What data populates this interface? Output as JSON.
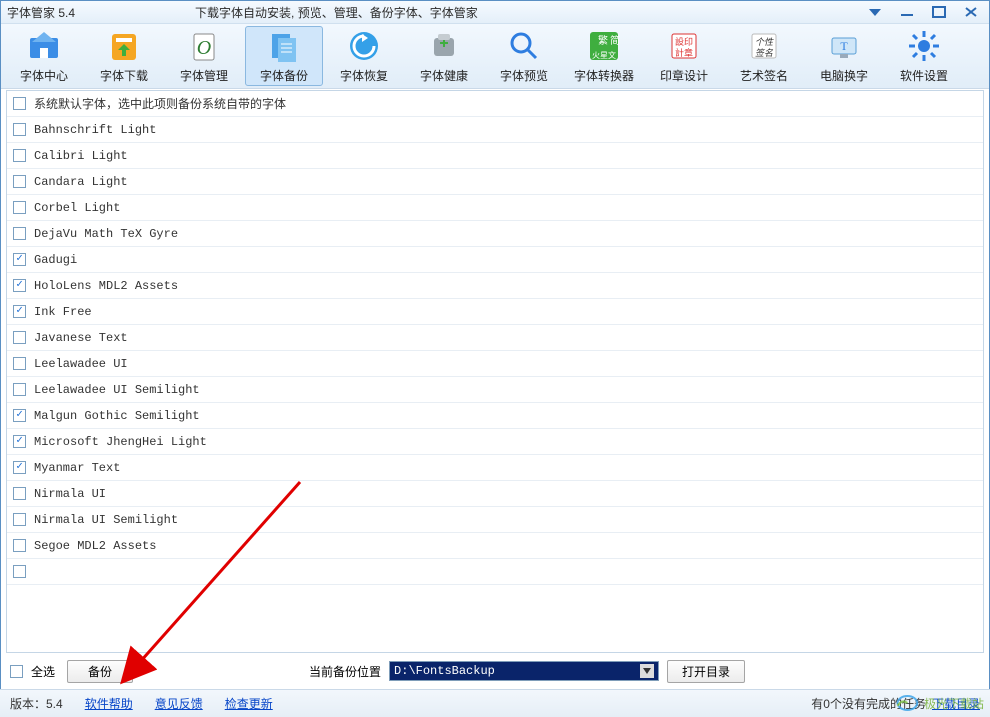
{
  "window": {
    "title": "字体管家 5.4",
    "subtitle": "下载字体自动安装, 预览、管理、备份字体、字体管家"
  },
  "toolbar": [
    {
      "id": "center",
      "label": "字体中心"
    },
    {
      "id": "download",
      "label": "字体下载"
    },
    {
      "id": "manage",
      "label": "字体管理"
    },
    {
      "id": "backup",
      "label": "字体备份",
      "active": true
    },
    {
      "id": "restore",
      "label": "字体恢复"
    },
    {
      "id": "health",
      "label": "字体健康"
    },
    {
      "id": "preview",
      "label": "字体预览"
    },
    {
      "id": "convert",
      "label": "字体转换器"
    },
    {
      "id": "seal",
      "label": "印章设计"
    },
    {
      "id": "sign",
      "label": "艺术签名"
    },
    {
      "id": "swap",
      "label": "电脑换字"
    },
    {
      "id": "settings",
      "label": "软件设置"
    }
  ],
  "fonts": [
    {
      "label": "系统默认字体，选中此项则备份系统自带的字体",
      "checked": false
    },
    {
      "label": "Bahnschrift Light",
      "checked": false
    },
    {
      "label": "Calibri Light",
      "checked": false
    },
    {
      "label": "Candara Light",
      "checked": false
    },
    {
      "label": "Corbel Light",
      "checked": false
    },
    {
      "label": "DejaVu Math TeX Gyre",
      "checked": false
    },
    {
      "label": "Gadugi",
      "checked": true
    },
    {
      "label": "HoloLens MDL2 Assets",
      "checked": true
    },
    {
      "label": "Ink Free",
      "checked": true
    },
    {
      "label": "Javanese Text",
      "checked": false
    },
    {
      "label": "Leelawadee UI",
      "checked": false
    },
    {
      "label": "Leelawadee UI Semilight",
      "checked": false
    },
    {
      "label": "Malgun Gothic Semilight",
      "checked": true
    },
    {
      "label": "Microsoft JhengHei Light",
      "checked": true
    },
    {
      "label": "Myanmar Text",
      "checked": true
    },
    {
      "label": "Nirmala UI",
      "checked": false
    },
    {
      "label": "Nirmala UI Semilight",
      "checked": false
    },
    {
      "label": "Segoe MDL2 Assets",
      "checked": false
    }
  ],
  "bottom": {
    "select_all": "全选",
    "select_all_checked": false,
    "backup_btn": "备份",
    "path_label": "当前备份位置",
    "path_value": "D:\\FontsBackup",
    "open_dir": "打开目录"
  },
  "status": {
    "version": "版本：5.4",
    "help": "软件帮助",
    "feedback": "意见反馈",
    "update": "检查更新",
    "tasks": "有0个没有完成的任务",
    "dl_dir": "下载目录"
  },
  "watermark": "极光下载站"
}
